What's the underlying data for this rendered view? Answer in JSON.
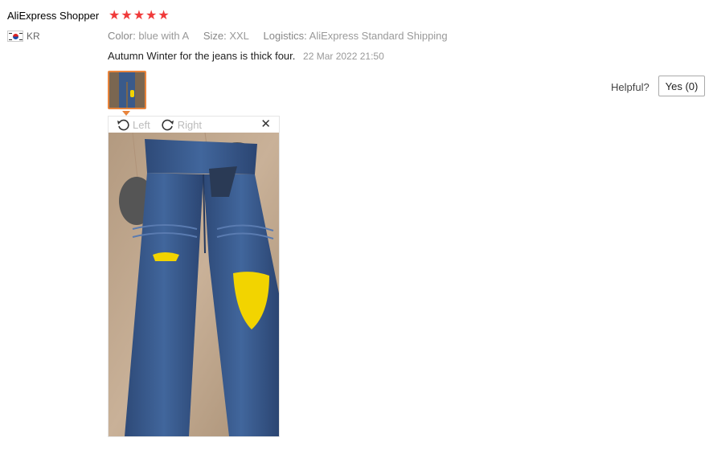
{
  "review": {
    "user_name": "AliExpress Shopper",
    "rating": 5,
    "country_code": "KR",
    "color_label": "Color:",
    "color_value": "blue with A",
    "size_label": "Size:",
    "size_value": "XXL",
    "logistics_label": "Logistics:",
    "logistics_value": "AliExpress Standard Shipping",
    "text": "Autumn Winter for the jeans is thick four.",
    "date": "22 Mar 2022 21:50"
  },
  "helpful": {
    "label": "Helpful?",
    "button_label": "Yes (0)"
  },
  "viewer": {
    "rotate_left_label": "Left",
    "rotate_right_label": "Right",
    "close_icon": "close-icon"
  },
  "colors": {
    "star": "#f03a3a",
    "thumb_border": "#e8843c"
  }
}
